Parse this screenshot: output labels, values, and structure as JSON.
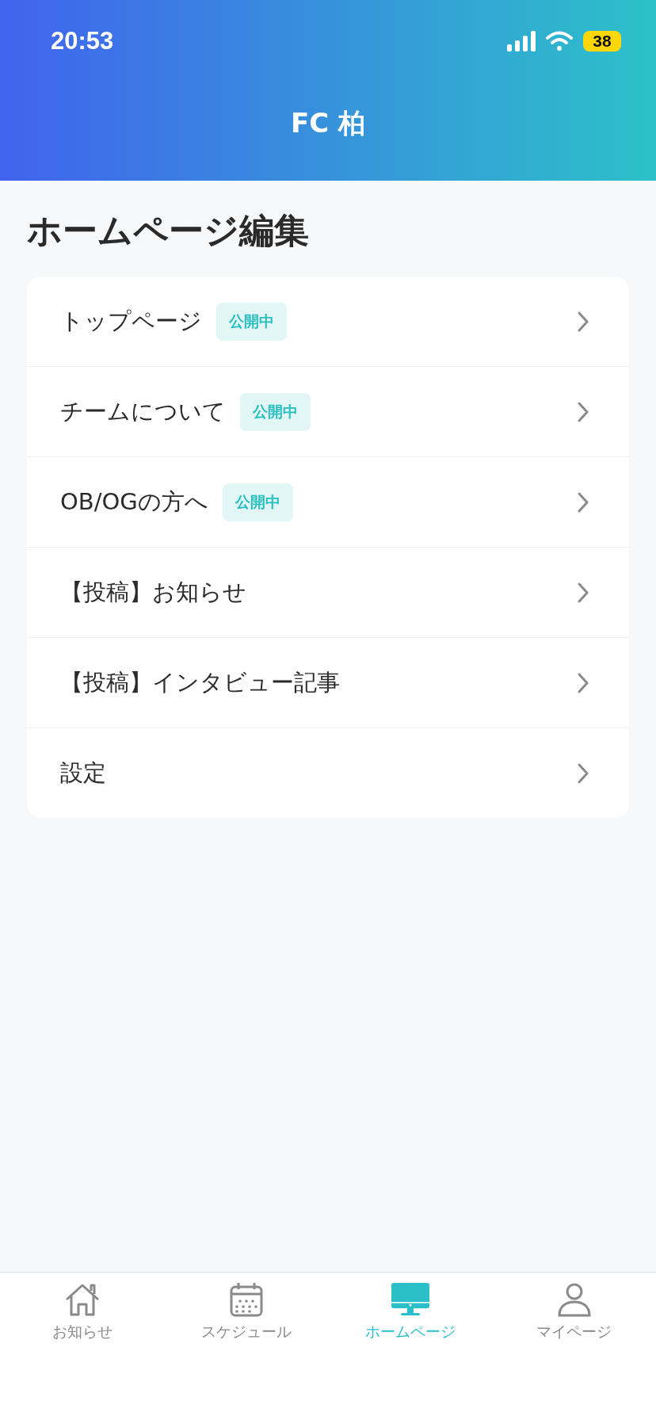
{
  "status_bar": {
    "time": "20:53",
    "battery": "38"
  },
  "header": {
    "title": "FC 柏"
  },
  "page_title": "ホームページ編集",
  "menu": [
    {
      "label": "トップページ",
      "badge": "公開中"
    },
    {
      "label": "チームについて",
      "badge": "公開中"
    },
    {
      "label": "OB/OGの方へ",
      "badge": "公開中"
    },
    {
      "label": "【投稿】お知らせ"
    },
    {
      "label": "【投稿】インタビュー記事"
    },
    {
      "label": "設定"
    }
  ],
  "tab_bar": [
    {
      "label": "お知らせ",
      "kind": "home",
      "selected": false
    },
    {
      "label": "スケジュール",
      "kind": "calendar",
      "selected": false
    },
    {
      "label": "ホームページ",
      "kind": "monitor",
      "selected": true
    },
    {
      "label": "マイページ",
      "kind": "user",
      "selected": false
    }
  ]
}
